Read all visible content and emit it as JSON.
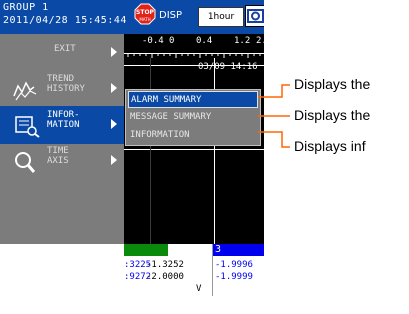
{
  "header": {
    "group": "GROUP 1",
    "datetime": "2011/04/28 15:45:44",
    "disp_label": "DISP",
    "time_button": "1hour",
    "colors": {
      "header_bg": "#0a4aa6",
      "menu_bg": "#7c7c7c"
    }
  },
  "scale": {
    "ticks": [
      "-0.4",
      "0",
      "0.4",
      "1.2",
      "2."
    ]
  },
  "chart": {
    "timestamp": "03/09 14:16"
  },
  "menu": {
    "items": [
      {
        "label": "EXIT",
        "icon": "none"
      },
      {
        "label": "TREND\nHISTORY",
        "icon": "trend-icon"
      },
      {
        "label": "INFOR-\nMATION",
        "icon": "information-icon"
      },
      {
        "label": "TIME\nAXIS",
        "icon": "magnifier-icon"
      }
    ],
    "selected": "INFOR-MATION"
  },
  "submenu": {
    "items": [
      "ALARM SUMMARY",
      "MESSAGE SUMMARY",
      "INFORMATION"
    ],
    "selected": "ALARM SUMMARY"
  },
  "bottom": {
    "col1": {
      "line1": ":3225",
      "line2": ":9272",
      "color": "#0a8a0a"
    },
    "col2": {
      "line1": "-1.3252",
      "line2": "-2.0000",
      "unit": "V"
    },
    "col3": {
      "channel": "3",
      "line1": "-1.9996",
      "line2": "-1.9999",
      "color": "#0000ee"
    }
  },
  "annotations": [
    "Displays the",
    "Displays the",
    "Displays inf"
  ]
}
